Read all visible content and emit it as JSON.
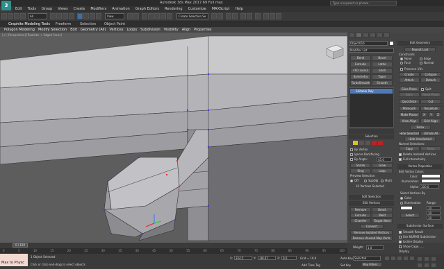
{
  "title_bar": {
    "title": "Autodesk 3ds Max 2017.69   Full max",
    "search_placeholder": "Type a keyword or phrase"
  },
  "logo_text": "3",
  "menu": [
    "Edit",
    "Tools",
    "Group",
    "Views",
    "Create",
    "Modifiers",
    "Animation",
    "Graph Editors",
    "Rendering",
    "Customize",
    "MAXScript",
    "Help"
  ],
  "toolbar": {
    "selection_filter": "All",
    "reference_coord": "View",
    "named_selection": "Create Selection Se"
  },
  "ribbon_tabs": [
    "Graphite Modeling Tools",
    "Freeform",
    "Selection",
    "Object Paint"
  ],
  "ribbon_sub": [
    "Polygon Modeling",
    "Modify Selection",
    "Edit",
    "Geometry (All)",
    "Vertices",
    "Loops",
    "Subdivision",
    "Visibility",
    "Align",
    "Properties"
  ],
  "viewport": {
    "label": "[+] [Perspective] [Realistic + Edged Faces]",
    "background": "#5d5d5d"
  },
  "command_panel": {
    "object_name": "Object016",
    "modifier_list_label": "Modifier List",
    "modifier_buttons": [
      [
        "Bend",
        "Bevel"
      ],
      [
        "Extrude",
        "Lathe"
      ],
      [
        "FFD 3x3x3",
        "Shell"
      ],
      [
        "Symmetry",
        "Taper"
      ],
      [
        "TurboSmooth",
        "Smooth"
      ]
    ],
    "stack_item": "Editable Poly",
    "selection": {
      "header": "Selection",
      "by_vertex": "By Vertex",
      "ignore_backfacing": "Ignore Backfacing",
      "by_angle": "By Angle:",
      "angle_value": "45.0",
      "shrink": "Shrink",
      "grow": "Grow",
      "ring": "Ring",
      "loop": "Loop",
      "preview_selection": "Preview Selection",
      "preview_options": [
        "Off",
        "SubObj",
        "Multi"
      ],
      "status": "10 Vertices Selected"
    },
    "soft_selection": "Soft Selection",
    "edit_vertices": {
      "header": "Edit Vertices",
      "buttons": [
        [
          "Remove",
          "Break"
        ],
        [
          "Extrude",
          "Weld"
        ],
        [
          "Chamfer",
          "Target Weld"
        ]
      ],
      "connect": "Connect",
      "remove_isolated": "Remove Isolated Vertices",
      "remove_unused": "Remove Unused Map Verts",
      "weight_label": "Weight:",
      "weight_value": "1.0"
    }
  },
  "right_panel": {
    "edit_geometry": "Edit Geometry",
    "repeat_last": "Repeat Last",
    "constraints": "Constraints",
    "constraint_options": [
      "None",
      "Edge",
      "Face",
      "Normal"
    ],
    "preserve_uvs": "Preserve UVs",
    "create": "Create",
    "collapse": "Collapse",
    "attach": "Attach",
    "detach": "Detach",
    "slice_plane": "Slice Plane",
    "split": "Split",
    "slice": "Slice",
    "reset_plane": "Reset Plane",
    "quickslice": "QuickSlice",
    "cut": "Cut",
    "msmooth": "MSmooth",
    "tessellate": "Tessellate",
    "make_planar": "Make Planar",
    "xyz": [
      "X",
      "Y",
      "Z"
    ],
    "view_align": "View Align",
    "grid_align": "Grid Align",
    "relax": "Relax",
    "hide_selected": "Hide Selected",
    "unhide_all": "Unhide All",
    "hide_unselected": "Hide Unselected",
    "named_selections": "Named Selections:",
    "copy": "Copy",
    "paste": "Paste",
    "delete_isolated": "Delete Isolated Vertices",
    "full_interactivity": "Full Interactivity",
    "vertex_properties": "Vertex Properties",
    "edit_vertex_colors": "Edit Vertex Colors",
    "color_label": "Color:",
    "illumination_label": "Illumination:",
    "alpha_label": "Alpha:",
    "alpha_value": "100.0",
    "select_vertices_by": "Select Vertices By",
    "color_option": "Color",
    "illumination_option": "Illumination",
    "range_label": "Range:",
    "range_values": [
      "10",
      "10",
      "10"
    ],
    "select_btn": "Select",
    "subdivision_surface": "Subdivision Surface",
    "smooth_result": "Smooth Result",
    "use_nurms": "Use NURMS Subdivision",
    "isoline_display": "Isoline Display",
    "show_cage": "Show Cage......",
    "display": "Display"
  },
  "timeline": {
    "slider": "0 / 100",
    "ticks": [
      "0",
      "5",
      "10",
      "15",
      "20",
      "25",
      "30",
      "35",
      "40",
      "45",
      "50",
      "55",
      "60",
      "65",
      "70",
      "75",
      "80",
      "85",
      "90",
      "95",
      "100"
    ]
  },
  "status": {
    "maxscript": "Max to Physc",
    "selected": "1 Object Selected",
    "prompt": "Click or click-and-drag to select objects",
    "x_label": "X:",
    "x_value": "324.5",
    "y_label": "Y:",
    "y_value": "-90.47",
    "z_label": "Z:",
    "z_value": "0.0",
    "grid": "Grid = 10.0",
    "add_time_tag": "Add Time Tag",
    "auto_key": "Auto Key",
    "selected_dropdown": "Selected",
    "set_key": "Set Key",
    "key_filters": "Key Filters..."
  }
}
